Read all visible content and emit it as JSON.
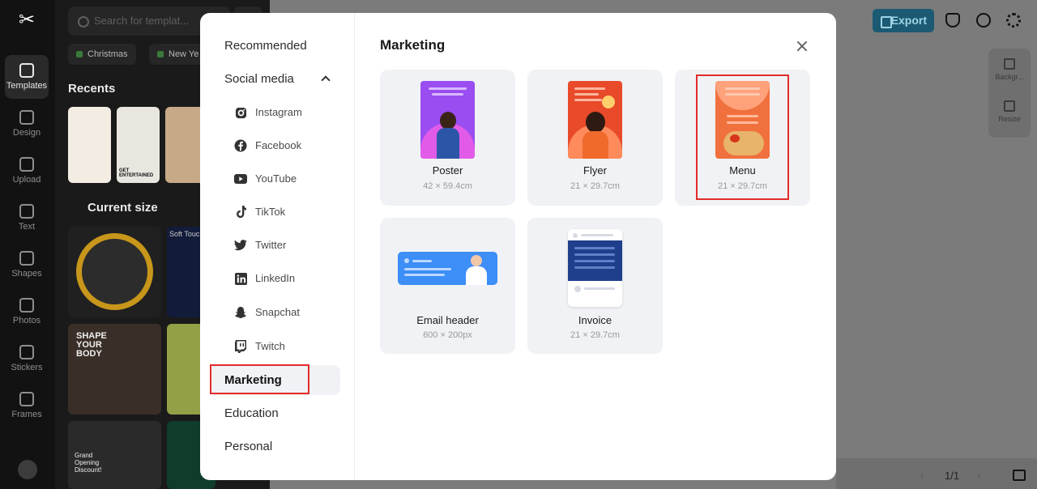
{
  "app": {
    "rail": [
      {
        "label": "Templates",
        "icon": "templates-icon",
        "active": true
      },
      {
        "label": "Design",
        "icon": "design-icon"
      },
      {
        "label": "Upload",
        "icon": "upload-icon"
      },
      {
        "label": "Text",
        "icon": "text-icon"
      },
      {
        "label": "Shapes",
        "icon": "shapes-icon"
      },
      {
        "label": "Photos",
        "icon": "photos-icon"
      },
      {
        "label": "Stickers",
        "icon": "stickers-icon"
      },
      {
        "label": "Frames",
        "icon": "frames-icon"
      }
    ],
    "panel": {
      "search_placeholder": "Search for templat...",
      "chips": [
        "Christmas",
        "New Ye"
      ],
      "recents_title": "Recents",
      "current_size_title": "Current size",
      "thumb_texts": {
        "soft_touch": "Soft Touch",
        "shape_body": "SHAPE YOUR BODY",
        "grand_opening": "Grand Opening Discount!",
        "get_entertained": "GET ENTERTAINED"
      }
    },
    "topbar": {
      "export_label": "Export"
    },
    "right_tools": {
      "background": "Backgr...",
      "resize": "Resize"
    },
    "pager": "1/1"
  },
  "modal": {
    "title": "Marketing",
    "categories": {
      "recommended": "Recommended",
      "social_media": "Social media",
      "marketing": "Marketing",
      "education": "Education",
      "personal": "Personal"
    },
    "social_items": [
      {
        "label": "Instagram",
        "icon": "instagram-icon"
      },
      {
        "label": "Facebook",
        "icon": "facebook-icon"
      },
      {
        "label": "YouTube",
        "icon": "youtube-icon"
      },
      {
        "label": "TikTok",
        "icon": "tiktok-icon"
      },
      {
        "label": "Twitter",
        "icon": "twitter-icon"
      },
      {
        "label": "LinkedIn",
        "icon": "linkedin-icon"
      },
      {
        "label": "Snapchat",
        "icon": "snapchat-icon"
      },
      {
        "label": "Twitch",
        "icon": "twitch-icon"
      }
    ],
    "templates": [
      {
        "name": "Poster",
        "size": "42 × 59.4cm"
      },
      {
        "name": "Flyer",
        "size": "21 × 29.7cm"
      },
      {
        "name": "Menu",
        "size": "21 × 29.7cm"
      },
      {
        "name": "Email header",
        "size": "600 × 200px"
      },
      {
        "name": "Invoice",
        "size": "21 × 29.7cm"
      }
    ]
  },
  "colors": {
    "highlight": "#e32b2b",
    "accent": "#1c5a73"
  }
}
